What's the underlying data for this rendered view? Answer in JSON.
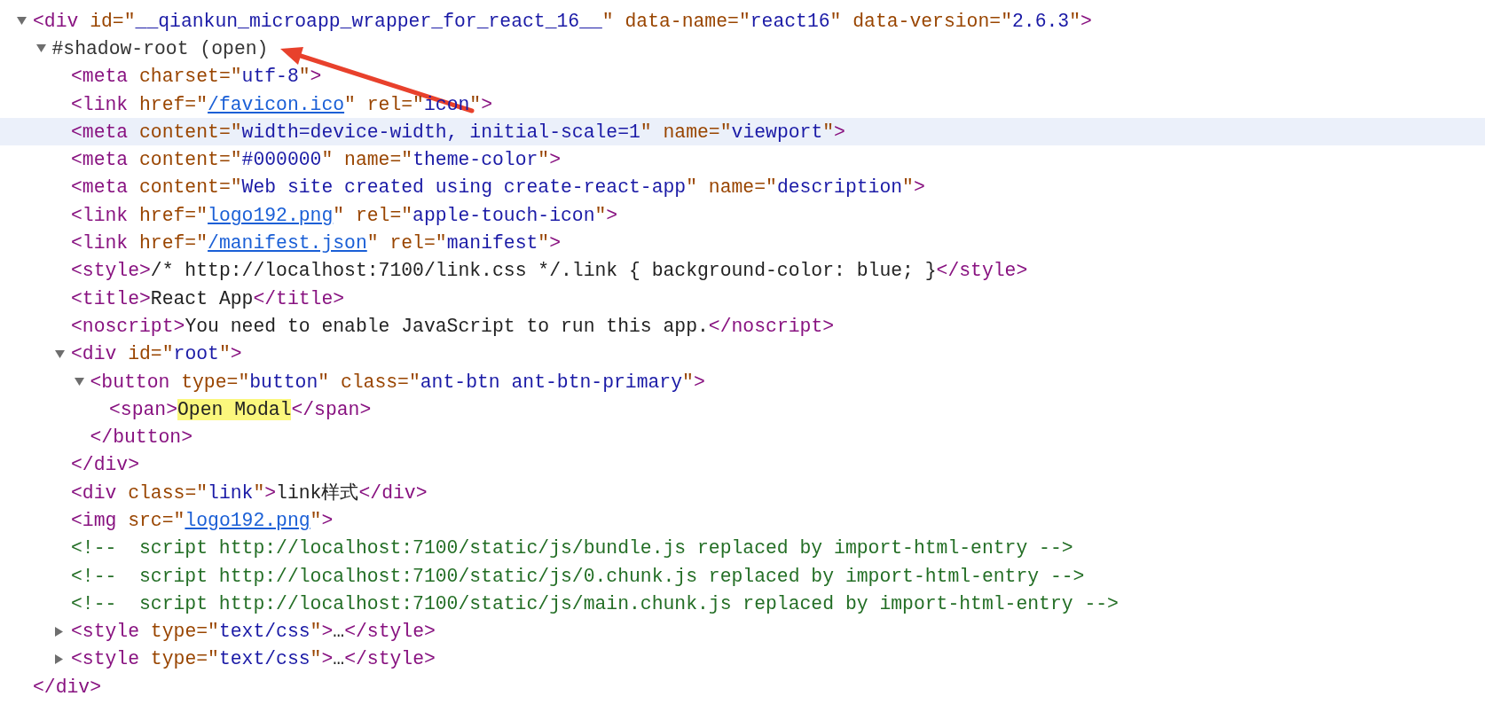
{
  "elements_tree": {
    "nodes": [
      {
        "kind": "parent",
        "expanded": true,
        "hovered": false,
        "tokens": [
          {
            "kind": "tag",
            "text": "<div"
          },
          {
            "kind": "attr",
            "text": " id=\""
          },
          {
            "kind": "val",
            "text": "__qiankun_microapp_wrapper_for_react_16__"
          },
          {
            "kind": "attr",
            "text": "\" data-name=\""
          },
          {
            "kind": "val",
            "text": "react16"
          },
          {
            "kind": "attr",
            "text": "\" data-version=\""
          },
          {
            "kind": "val",
            "text": "2.6.3"
          },
          {
            "kind": "attr",
            "text": "\""
          },
          {
            "kind": "tag",
            "text": ">"
          }
        ],
        "close": [
          {
            "kind": "tag",
            "text": "</div>"
          }
        ],
        "children": [
          {
            "kind": "parent",
            "expanded": true,
            "hovered": false,
            "tokens": [
              {
                "kind": "shadow",
                "text": "#shadow-root (open)"
              }
            ],
            "children": [
              {
                "kind": "leaf",
                "hovered": false,
                "tokens": [
                  {
                    "kind": "tag",
                    "text": "<meta"
                  },
                  {
                    "kind": "attr",
                    "text": " charset=\""
                  },
                  {
                    "kind": "val",
                    "text": "utf-8"
                  },
                  {
                    "kind": "attr",
                    "text": "\""
                  },
                  {
                    "kind": "tag",
                    "text": ">"
                  }
                ]
              },
              {
                "kind": "leaf",
                "hovered": false,
                "tokens": [
                  {
                    "kind": "tag",
                    "text": "<link"
                  },
                  {
                    "kind": "attr",
                    "text": " href=\""
                  },
                  {
                    "kind": "link",
                    "text": "/favicon.ico"
                  },
                  {
                    "kind": "attr",
                    "text": "\" rel=\""
                  },
                  {
                    "kind": "val",
                    "text": "icon"
                  },
                  {
                    "kind": "attr",
                    "text": "\""
                  },
                  {
                    "kind": "tag",
                    "text": ">"
                  }
                ]
              },
              {
                "kind": "leaf",
                "hovered": true,
                "tokens": [
                  {
                    "kind": "tag",
                    "text": "<meta"
                  },
                  {
                    "kind": "attr",
                    "text": " content=\""
                  },
                  {
                    "kind": "val",
                    "text": "width=device-width, initial-scale=1"
                  },
                  {
                    "kind": "attr",
                    "text": "\" name=\""
                  },
                  {
                    "kind": "val",
                    "text": "viewport"
                  },
                  {
                    "kind": "attr",
                    "text": "\""
                  },
                  {
                    "kind": "tag",
                    "text": ">"
                  }
                ]
              },
              {
                "kind": "leaf",
                "hovered": false,
                "tokens": [
                  {
                    "kind": "tag",
                    "text": "<meta"
                  },
                  {
                    "kind": "attr",
                    "text": " content=\""
                  },
                  {
                    "kind": "val",
                    "text": "#000000"
                  },
                  {
                    "kind": "attr",
                    "text": "\" name=\""
                  },
                  {
                    "kind": "val",
                    "text": "theme-color"
                  },
                  {
                    "kind": "attr",
                    "text": "\""
                  },
                  {
                    "kind": "tag",
                    "text": ">"
                  }
                ]
              },
              {
                "kind": "leaf",
                "hovered": false,
                "tokens": [
                  {
                    "kind": "tag",
                    "text": "<meta"
                  },
                  {
                    "kind": "attr",
                    "text": " content=\""
                  },
                  {
                    "kind": "val",
                    "text": "Web site created using create-react-app"
                  },
                  {
                    "kind": "attr",
                    "text": "\" name=\""
                  },
                  {
                    "kind": "val",
                    "text": "description"
                  },
                  {
                    "kind": "attr",
                    "text": "\""
                  },
                  {
                    "kind": "tag",
                    "text": ">"
                  }
                ]
              },
              {
                "kind": "leaf",
                "hovered": false,
                "tokens": [
                  {
                    "kind": "tag",
                    "text": "<link"
                  },
                  {
                    "kind": "attr",
                    "text": " href=\""
                  },
                  {
                    "kind": "link",
                    "text": "logo192.png"
                  },
                  {
                    "kind": "attr",
                    "text": "\" rel=\""
                  },
                  {
                    "kind": "val",
                    "text": "apple-touch-icon"
                  },
                  {
                    "kind": "attr",
                    "text": "\""
                  },
                  {
                    "kind": "tag",
                    "text": ">"
                  }
                ]
              },
              {
                "kind": "leaf",
                "hovered": false,
                "tokens": [
                  {
                    "kind": "tag",
                    "text": "<link"
                  },
                  {
                    "kind": "attr",
                    "text": " href=\""
                  },
                  {
                    "kind": "link",
                    "text": "/manifest.json"
                  },
                  {
                    "kind": "attr",
                    "text": "\" rel=\""
                  },
                  {
                    "kind": "val",
                    "text": "manifest"
                  },
                  {
                    "kind": "attr",
                    "text": "\""
                  },
                  {
                    "kind": "tag",
                    "text": ">"
                  }
                ]
              },
              {
                "kind": "leaf",
                "hovered": false,
                "tokens": [
                  {
                    "kind": "tag",
                    "text": "<style>"
                  },
                  {
                    "kind": "text",
                    "text": "/* http://localhost:7100/link.css */.link { background-color: blue; }"
                  },
                  {
                    "kind": "tag",
                    "text": "</style>"
                  }
                ]
              },
              {
                "kind": "leaf",
                "hovered": false,
                "tokens": [
                  {
                    "kind": "tag",
                    "text": "<title>"
                  },
                  {
                    "kind": "text",
                    "text": "React App"
                  },
                  {
                    "kind": "tag",
                    "text": "</title>"
                  }
                ]
              },
              {
                "kind": "leaf",
                "hovered": false,
                "tokens": [
                  {
                    "kind": "tag",
                    "text": "<noscript>"
                  },
                  {
                    "kind": "text",
                    "text": "You need to enable JavaScript to run this app."
                  },
                  {
                    "kind": "tag",
                    "text": "</noscript>"
                  }
                ]
              },
              {
                "kind": "parent",
                "expanded": true,
                "hovered": false,
                "tokens": [
                  {
                    "kind": "tag",
                    "text": "<div"
                  },
                  {
                    "kind": "attr",
                    "text": " id=\""
                  },
                  {
                    "kind": "val",
                    "text": "root"
                  },
                  {
                    "kind": "attr",
                    "text": "\""
                  },
                  {
                    "kind": "tag",
                    "text": ">"
                  }
                ],
                "close": [
                  {
                    "kind": "tag",
                    "text": "</div>"
                  }
                ],
                "children": [
                  {
                    "kind": "parent",
                    "expanded": true,
                    "hovered": false,
                    "tokens": [
                      {
                        "kind": "tag",
                        "text": "<button"
                      },
                      {
                        "kind": "attr",
                        "text": " type=\""
                      },
                      {
                        "kind": "val",
                        "text": "button"
                      },
                      {
                        "kind": "attr",
                        "text": "\" class=\""
                      },
                      {
                        "kind": "val",
                        "text": "ant-btn ant-btn-primary"
                      },
                      {
                        "kind": "attr",
                        "text": "\""
                      },
                      {
                        "kind": "tag",
                        "text": ">"
                      }
                    ],
                    "close": [
                      {
                        "kind": "tag",
                        "text": "</button>"
                      }
                    ],
                    "children": [
                      {
                        "kind": "leaf",
                        "hovered": false,
                        "tokens": [
                          {
                            "kind": "tag",
                            "text": "<span>"
                          },
                          {
                            "kind": "mark",
                            "text": "Open Modal"
                          },
                          {
                            "kind": "tag",
                            "text": "</span>"
                          }
                        ]
                      }
                    ]
                  }
                ]
              },
              {
                "kind": "leaf",
                "hovered": false,
                "tokens": [
                  {
                    "kind": "tag",
                    "text": "<div"
                  },
                  {
                    "kind": "attr",
                    "text": " class=\""
                  },
                  {
                    "kind": "val",
                    "text": "link"
                  },
                  {
                    "kind": "attr",
                    "text": "\""
                  },
                  {
                    "kind": "tag",
                    "text": ">"
                  },
                  {
                    "kind": "text",
                    "text": "link样式"
                  },
                  {
                    "kind": "tag",
                    "text": "</div>"
                  }
                ]
              },
              {
                "kind": "leaf",
                "hovered": false,
                "tokens": [
                  {
                    "kind": "tag",
                    "text": "<img"
                  },
                  {
                    "kind": "attr",
                    "text": " src=\""
                  },
                  {
                    "kind": "link",
                    "text": "logo192.png"
                  },
                  {
                    "kind": "attr",
                    "text": "\""
                  },
                  {
                    "kind": "tag",
                    "text": ">"
                  }
                ]
              },
              {
                "kind": "leaf",
                "hovered": false,
                "tokens": [
                  {
                    "kind": "comment",
                    "text": "<!--  script http://localhost:7100/static/js/bundle.js replaced by import-html-entry -->"
                  }
                ]
              },
              {
                "kind": "leaf",
                "hovered": false,
                "tokens": [
                  {
                    "kind": "comment",
                    "text": "<!--  script http://localhost:7100/static/js/0.chunk.js replaced by import-html-entry -->"
                  }
                ]
              },
              {
                "kind": "leaf",
                "hovered": false,
                "tokens": [
                  {
                    "kind": "comment",
                    "text": "<!--  script http://localhost:7100/static/js/main.chunk.js replaced by import-html-entry -->"
                  }
                ]
              },
              {
                "kind": "parent",
                "expanded": false,
                "hovered": false,
                "tokens": [
                  {
                    "kind": "tag",
                    "text": "<style"
                  },
                  {
                    "kind": "attr",
                    "text": " type=\""
                  },
                  {
                    "kind": "val",
                    "text": "text/css"
                  },
                  {
                    "kind": "attr",
                    "text": "\""
                  },
                  {
                    "kind": "tag",
                    "text": ">"
                  },
                  {
                    "kind": "text",
                    "text": "…"
                  },
                  {
                    "kind": "tag",
                    "text": "</style>"
                  }
                ]
              },
              {
                "kind": "parent",
                "expanded": false,
                "hovered": false,
                "tokens": [
                  {
                    "kind": "tag",
                    "text": "<style"
                  },
                  {
                    "kind": "attr",
                    "text": " type=\""
                  },
                  {
                    "kind": "val",
                    "text": "text/css"
                  },
                  {
                    "kind": "attr",
                    "text": "\""
                  },
                  {
                    "kind": "tag",
                    "text": ">"
                  },
                  {
                    "kind": "text",
                    "text": "…"
                  },
                  {
                    "kind": "tag",
                    "text": "</style>"
                  }
                ]
              }
            ]
          }
        ]
      }
    ]
  }
}
